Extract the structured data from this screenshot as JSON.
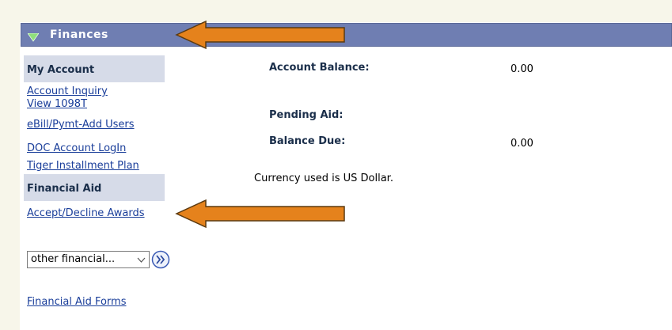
{
  "header": {
    "title": "Finances",
    "toggle_icon": "triangle-down-icon"
  },
  "sidebar": {
    "my_account": {
      "heading": "My Account",
      "links": [
        "Account Inquiry",
        "View 1098T",
        "eBill/Pymt-Add Users",
        "DOC Account LogIn",
        "Tiger Installment Plan"
      ]
    },
    "financial_aid": {
      "heading": "Financial Aid",
      "links": [
        "Accept/Decline Awards"
      ]
    },
    "select": {
      "value": "other financial...",
      "go_icon": "double-chevron-right-icon"
    },
    "forms_link": "Financial Aid Forms"
  },
  "summary": {
    "account_balance_label": "Account Balance:",
    "account_balance_value": "0.00",
    "pending_aid_label": "Pending Aid:",
    "balance_due_label": "Balance Due:",
    "balance_due_value": "0.00",
    "currency_note": "Currency used is US Dollar."
  },
  "colors": {
    "header_bg": "#6f7eb2",
    "section_bg": "#d6dbe8",
    "link": "#1a3e9a",
    "callout": "#e5821c"
  }
}
